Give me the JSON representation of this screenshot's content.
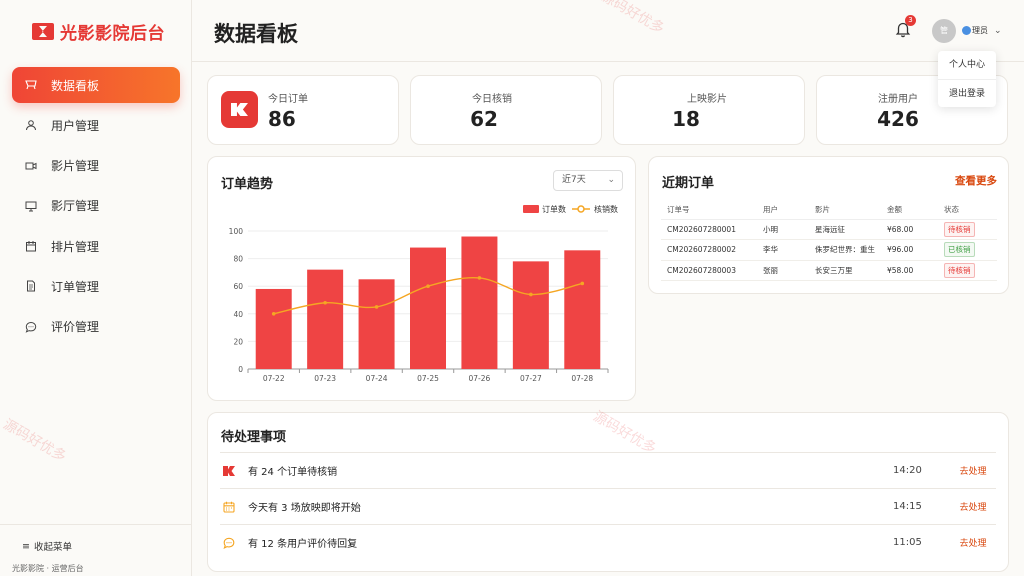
{
  "brand": {
    "name": "光影影院后台"
  },
  "nav": {
    "items": [
      {
        "label": "数据看板"
      },
      {
        "label": "用户管理"
      },
      {
        "label": "影片管理"
      },
      {
        "label": "影厅管理"
      },
      {
        "label": "排片管理"
      },
      {
        "label": "订单管理"
      },
      {
        "label": "评价管理"
      }
    ],
    "collapse_label": "收起菜单",
    "footer": "光影影院 · 运营后台"
  },
  "header": {
    "title": "数据看板",
    "notification_count": "3",
    "avatar_text": "管",
    "user_label": "理员"
  },
  "user_menu": {
    "items": [
      "个人中心",
      "退出登录"
    ]
  },
  "stats": [
    {
      "label": "今日订单",
      "value": "86"
    },
    {
      "label": "今日核销",
      "value": "62"
    },
    {
      "label": "上映影片",
      "value": "18"
    },
    {
      "label": "注册用户",
      "value": "426"
    }
  ],
  "trend": {
    "title": "订单趋势",
    "range_select": "近7天"
  },
  "chart_data": {
    "type": "bar",
    "categories": [
      "07-22",
      "07-23",
      "07-24",
      "07-25",
      "07-26",
      "07-27",
      "07-28"
    ],
    "series": [
      {
        "name": "订单数",
        "type": "bar",
        "color": "#ef4444",
        "values": [
          58,
          72,
          65,
          88,
          96,
          78,
          86
        ]
      },
      {
        "name": "核销数",
        "type": "line",
        "color": "#f5a623",
        "values": [
          40,
          48,
          45,
          60,
          66,
          54,
          62
        ]
      }
    ],
    "ylim": [
      0,
      100
    ],
    "yticks": [
      "0",
      "20",
      "40",
      "60",
      "80",
      "100"
    ],
    "legend": "top-right",
    "grid": true
  },
  "recent_orders": {
    "title": "近期订单",
    "more_label": "查看更多",
    "columns": [
      "订单号",
      "用户",
      "影片",
      "金额",
      "状态"
    ],
    "rows": [
      {
        "id": "CM202607280001",
        "user": "小明",
        "movie": "星海远征",
        "amount": "¥68.00",
        "status": "待核销"
      },
      {
        "id": "CM202607280002",
        "user": "李华",
        "movie": "侏罗纪世界：重生",
        "amount": "¥96.00",
        "status": "已核销"
      },
      {
        "id": "CM202607280003",
        "user": "张丽",
        "movie": "长安三万里",
        "amount": "¥58.00",
        "status": "待核销"
      }
    ],
    "status_colors": {
      "待核销": "#e53935",
      "已核销": "#43a047"
    }
  },
  "todos": {
    "title": "待处理事项",
    "items": [
      {
        "icon": "ticket-icon",
        "text": "有 24 个订单待核销",
        "time": "14:20",
        "action": "去处理"
      },
      {
        "icon": "calendar-icon",
        "text": "今天有 3 场放映即将开始",
        "time": "14:15",
        "action": "去处理"
      },
      {
        "icon": "chat-icon",
        "text": "有 12 条用户评价待回复",
        "time": "11:05",
        "action": "去处理"
      }
    ]
  },
  "watermark": "源码好优多",
  "colors": {
    "accent": "#e53935",
    "accent_gradient_end": "#f7752a",
    "link": "#d9480f"
  }
}
